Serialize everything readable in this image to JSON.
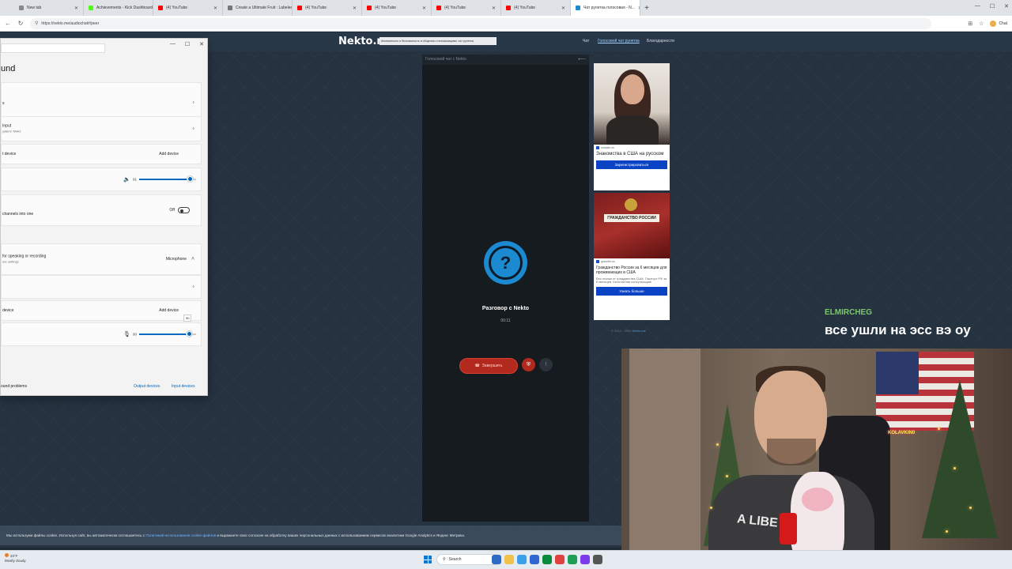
{
  "browser": {
    "tabs": [
      {
        "label": "New tab",
        "color": "#888888"
      },
      {
        "label": "Achievements - Kick Dashboard",
        "color": "#53fc18"
      },
      {
        "label": "(4) YouTube",
        "color": "#ff0000"
      },
      {
        "label": "Create a Ultimate Fruit : Labeled",
        "color": "#777777"
      },
      {
        "label": "(4) YouTube",
        "color": "#ff0000"
      },
      {
        "label": "(4) YouTube",
        "color": "#ff0000"
      },
      {
        "label": "(4) YouTube",
        "color": "#ff0000"
      },
      {
        "label": "(4) YouTube",
        "color": "#ff0000"
      },
      {
        "label": "Чат рулетка голосовая - N...",
        "color": "#1b8ad0"
      }
    ],
    "url": "https://nekto.me/audiochat#/peer",
    "profile_label": "Chat"
  },
  "site": {
    "logo": "Nekto.me",
    "tagline": "Анонимность и безопасность в общении с незнакомцами, чат рулетка",
    "nav": [
      "Чат",
      "Голосовой чат рулетка",
      "Благодарности"
    ],
    "chat": {
      "header": "Голосовой чат с Nekto",
      "status": "Разговор с Nekto",
      "timer": "00:11",
      "end_button": "Завершить"
    },
    "ads": [
      {
        "source": "rusdate.us",
        "title": "Знакомства в США на русском",
        "button": "Зарегистрироваться"
      },
      {
        "source": "gracefer.us",
        "image_text": "ГРАЖДАНСТВО РОССИИ",
        "title": "Гражданство России за 6 месяцев для проживающих в США",
        "description": "Без отказа от гражданства США. Паспорт РФ за 6 месяцев. Бесплатная консультация!",
        "button": "Узнать больше"
      }
    ],
    "ad_footer": "© 2014 - 2024",
    "ad_footer_link": "Nekto.me",
    "cookie_text_1": "Мы используем файлы cookie. Используя сайт, вы автоматически соглашаетесь с",
    "cookie_link": "Политикой использования cookie-файлов",
    "cookie_text_2": "и выражаете свое согласие на обработку ваших персональных данных с использованием сервисов аналитики Google Analytics и Яндекс Метрика."
  },
  "settings": {
    "title": "und",
    "rows": {
      "output_label": "s",
      "input_label": "Input",
      "input_sub": "ystem/ TAAO",
      "pair_label": "t device",
      "add_device": "Add device",
      "volume": "91",
      "mono_sub": "channels into one",
      "mono_state": "Off",
      "input_section": "for speaking or recording",
      "input_section_sub": "ore settings",
      "input_section_value": "Microphone",
      "pair_input_label": "device",
      "add_device_2": "Add device",
      "mic_volume": "90",
      "tooltip": "90"
    },
    "footer_left": "ound problems",
    "footer_output": "Output devices",
    "footer_input": "Input devices"
  },
  "stream": {
    "chat_user": "ELMIRCHEG",
    "chat_message": "все ушли на эсс вэ оу",
    "shirt_text": "A LIBE",
    "neon_text": "KOLAVKIN0"
  },
  "taskbar": {
    "temperature": "33°F",
    "weather": "Mostly cloudy",
    "search": "Search"
  }
}
